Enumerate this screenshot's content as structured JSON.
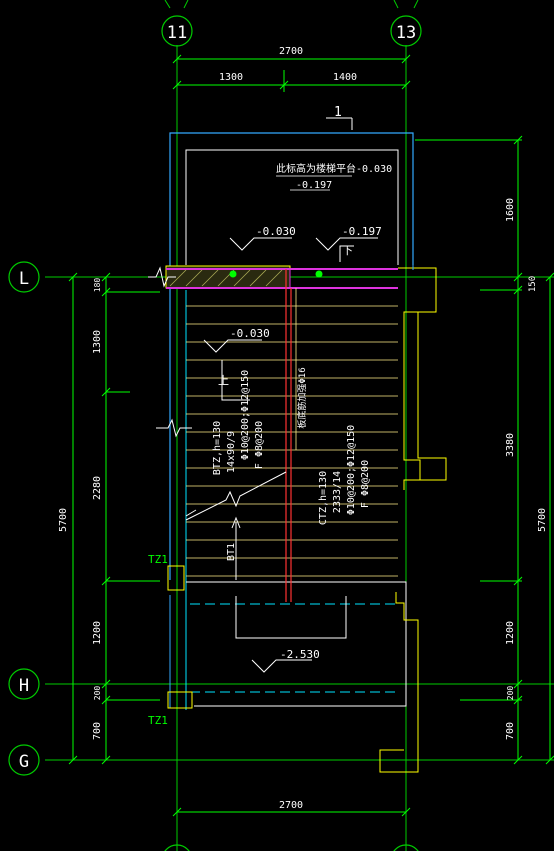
{
  "axes": {
    "top_left": "11",
    "top_right": "13",
    "row_l": "L",
    "row_h": "H",
    "row_g": "G"
  },
  "dims": {
    "top_total": "2700",
    "top_left": "1300",
    "top_right": "1400",
    "bottom_total": "2700",
    "left_total": "5700",
    "left_seg1": "180",
    "left_seg2": "1300",
    "left_seg3": "2280",
    "left_seg4": "1200",
    "left_seg5": "200",
    "left_seg6": "700",
    "right_total": "5700",
    "right_seg1": "1600",
    "right_seg2": "150",
    "right_seg3": "3380",
    "right_seg4": "1200",
    "right_seg5": "200",
    "right_seg6": "700"
  },
  "section_mark": "1",
  "levels": {
    "note_top": "此标高为楼梯平台-0.030",
    "note_top_level2": "-0.197",
    "level_a": "-0.030",
    "level_b": "-0.197",
    "level_c": "-0.030",
    "level_bottom": "-2.530"
  },
  "labels": {
    "up": "上",
    "down": "下",
    "rebar_note": "板底筋加强Φ16",
    "btz_line1": "BTZ,h=130",
    "btz_line2": "14x90/9",
    "btz_line3": "Φ10@200;Φ12@150",
    "btz_line4": "F Φ8@200",
    "ctz_line1": "CTZ,h=130",
    "ctz_line2": "2333/14",
    "ctz_line3": "Φ10@200;Φ12@150",
    "ctz_line4": "F Φ8@200",
    "bt1": "BT1",
    "tz1_upper": "TZ1",
    "tz1_lower": "TZ1"
  },
  "colors": {
    "background": "#000000",
    "axis": "#00cc00",
    "wall": "#33aaff",
    "wall_inner": "#00e5ff",
    "tread": "#ffee88",
    "dim_text": "#ffffff",
    "dim_line": "#00ff00",
    "beam": "#dd33dd",
    "column": "#ffff00",
    "green_dot": "#00ff00",
    "rebar": "#ff3333",
    "beam_outline": "#ffff00"
  }
}
